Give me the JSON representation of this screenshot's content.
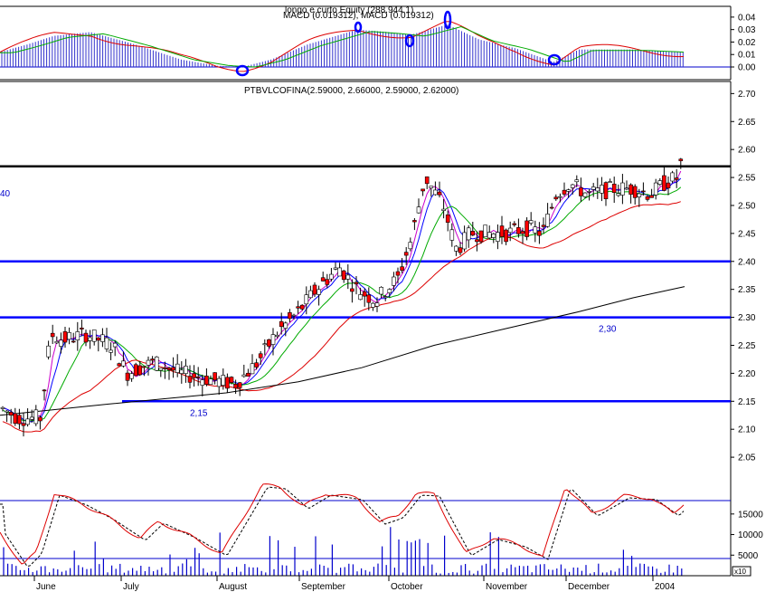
{
  "chart_data": {
    "type": "candlestick",
    "panels": {
      "macd": {
        "title": "MACD (0.019312), MACD (0.019312)",
        "overlay_title": "longo e curto Equity (288.944.1)",
        "ylim": [
          -0.005,
          0.045
        ],
        "yticks": [
          "0.00",
          "0.01",
          "0.02",
          "0.03",
          "0.04"
        ]
      },
      "price": {
        "title": "PTBVLCOFINA(2.59000, 2.66000, 2.59000, 2.62000)",
        "ylim": [
          2.0,
          2.72
        ],
        "yticks": [
          "2.05",
          "2.10",
          "2.15",
          "2.20",
          "2.25",
          "2.30",
          "2.35",
          "2.40",
          "2.45",
          "2.50",
          "2.55",
          "2.60",
          "2.65",
          "2.70"
        ],
        "left_edge_label": "40",
        "resistance": 2.57,
        "levels": [
          {
            "value": 2.4,
            "label": ""
          },
          {
            "value": 2.3,
            "label": "2,30"
          },
          {
            "value": 2.15,
            "label": "2,15"
          }
        ]
      },
      "volume": {
        "yticks": [
          "5000",
          "10000",
          "15000"
        ],
        "unit_label": "x10",
        "ylim": [
          0,
          22000
        ]
      }
    },
    "x_labels": [
      "June",
      "July",
      "August",
      "September",
      "October",
      "November",
      "December",
      "2004"
    ],
    "colors": {
      "ma_fast": "#0000ff",
      "ma_short": "#cc00cc",
      "ma_mid": "#00aa00",
      "ma_long": "#dd0000",
      "ma_200": "#000000",
      "level_line": "#0000ff",
      "resistance_line": "#000000",
      "down_fill": "#ff0000",
      "up_fill": "#ffffff"
    }
  }
}
